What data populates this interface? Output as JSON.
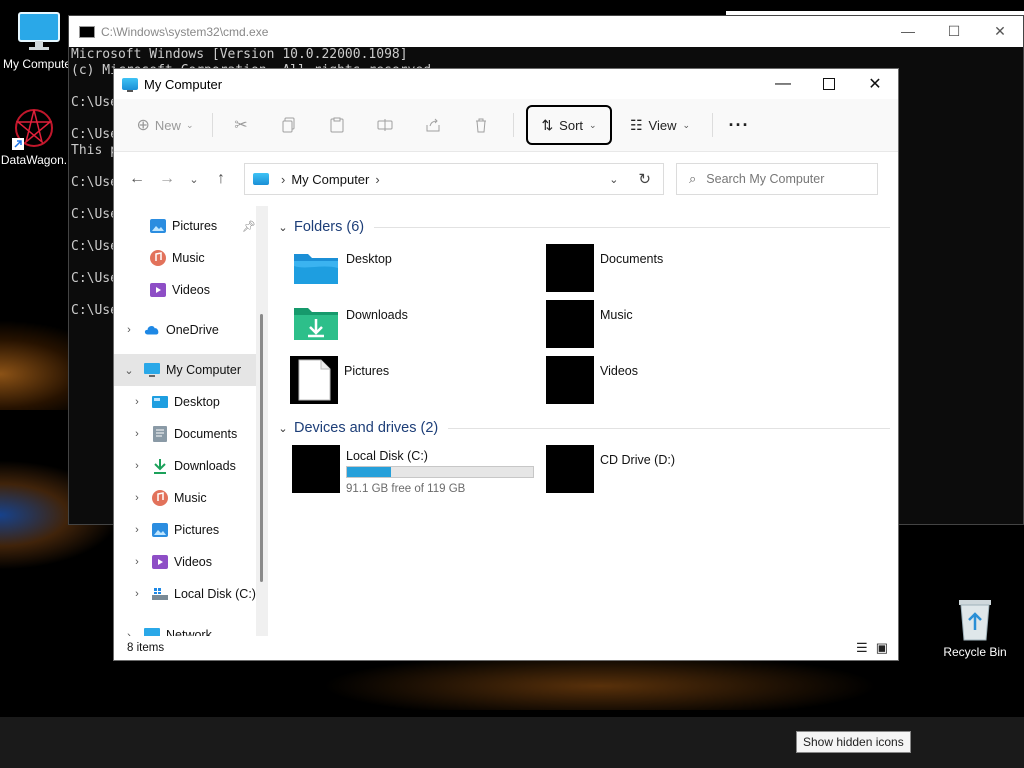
{
  "desktop": {
    "icons": [
      {
        "label": "My Computer",
        "icon": "monitor-icon"
      },
      {
        "label": "DataWagon.",
        "icon": "datawagon-icon"
      },
      {
        "label": "Recycle Bin",
        "icon": "recycle-bin-icon"
      }
    ],
    "tooltip": "Show hidden icons"
  },
  "cmd": {
    "title": "C:\\Windows\\system32\\cmd.exe",
    "lines": [
      "Microsoft Windows [Version 10.0.22000.1098]",
      "(c) Microsoft Corporation. All rights reserved.",
      "",
      "C:\\Use",
      "",
      "C:\\Use",
      "This p",
      "",
      "C:\\Use",
      "",
      "C:\\Use",
      "",
      "C:\\Use",
      "",
      "C:\\Use",
      "",
      "C:\\Use"
    ]
  },
  "explorer": {
    "title": "My Computer",
    "toolbar": {
      "new_label": "New",
      "sort_label": "Sort",
      "view_label": "View",
      "more_label": "···"
    },
    "address": {
      "path": "My Computer",
      "search_placeholder": "Search My Computer"
    },
    "sidebar": {
      "items": [
        {
          "label": "Pictures",
          "pinned": true
        },
        {
          "label": "Music"
        },
        {
          "label": "Videos"
        },
        {
          "label": "OneDrive"
        },
        {
          "label": "My Computer"
        },
        {
          "label": "Desktop"
        },
        {
          "label": "Documents"
        },
        {
          "label": "Downloads"
        },
        {
          "label": "Music"
        },
        {
          "label": "Pictures"
        },
        {
          "label": "Videos"
        },
        {
          "label": "Local Disk (C:)"
        },
        {
          "label": "Network"
        }
      ]
    },
    "folders_header": "Folders (6)",
    "folders": [
      {
        "name": "Desktop"
      },
      {
        "name": "Documents"
      },
      {
        "name": "Downloads"
      },
      {
        "name": "Music"
      },
      {
        "name": "Pictures"
      },
      {
        "name": "Videos"
      }
    ],
    "drives_header": "Devices and drives (2)",
    "drives": [
      {
        "name": "Local Disk (C:)",
        "free": "91.1 GB free of 119 GB",
        "used_fraction": 0.234
      },
      {
        "name": "CD Drive (D:)"
      }
    ],
    "status": "8 items"
  },
  "colors": {
    "accent": "#26a0da",
    "section_header": "#1d3e78",
    "selection": "#e5e5e5"
  }
}
